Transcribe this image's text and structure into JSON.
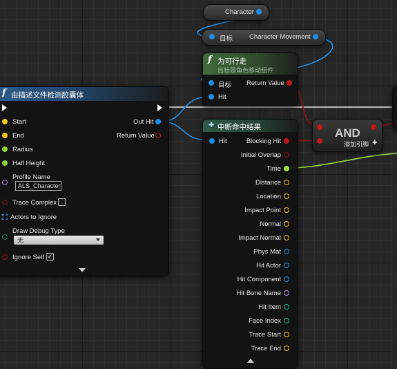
{
  "colors": {
    "exec": "#ffffff",
    "vector": "#f5c518",
    "float": "#89d33b",
    "object": "#1f8ee8",
    "bool": "#8b1414",
    "name": "#b286e8",
    "struct": "#0a6fb8",
    "lime": "#a0e040",
    "teal": "#22b8a0"
  },
  "character_node": {
    "label": "Character"
  },
  "movement_node": {
    "target_label": "目标",
    "output_label": "Character Movement"
  },
  "can_move_node": {
    "title": "为可行走",
    "subtitle": "目标是角色移动组件",
    "target_label": "目标",
    "hit_label": "Hit",
    "return_label": "Return Value"
  },
  "capsule_trace_node": {
    "title": "由描述文件检测胶囊体",
    "inputs": {
      "start": "Start",
      "end": "End",
      "radius": "Radius",
      "half_height": "Half Height",
      "profile_name": "Profile Name",
      "profile_value": "ALS_Character",
      "trace_complex": "Trace Complex",
      "actors_to_ignore": "Actors to Ignore",
      "draw_debug_type": "Draw Debug Type",
      "draw_debug_value": "无",
      "ignore_self": "Ignore Self"
    },
    "outputs": {
      "out_hit": "Out Hit",
      "return_value": "Return Value"
    },
    "trace_complex_checked": false,
    "ignore_self_checked": true
  },
  "break_hit_node": {
    "title": "中断命中结果",
    "input_label": "Hit",
    "outputs": [
      {
        "label": "Blocking Hit",
        "pin": "bool"
      },
      {
        "label": "Initial Overlap",
        "pin": "bool"
      },
      {
        "label": "Time",
        "pin": "float"
      },
      {
        "label": "Distance",
        "pin": "vector"
      },
      {
        "label": "Location",
        "pin": "vector"
      },
      {
        "label": "Impact Point",
        "pin": "vector"
      },
      {
        "label": "Normal",
        "pin": "vector"
      },
      {
        "label": "Impact Normal",
        "pin": "vector"
      },
      {
        "label": "Phys Mat",
        "pin": "object"
      },
      {
        "label": "Hit Actor",
        "pin": "object"
      },
      {
        "label": "Hit Component",
        "pin": "object"
      },
      {
        "label": "Hit Bone Name",
        "pin": "name"
      },
      {
        "label": "Hit Item",
        "pin": "teal"
      },
      {
        "label": "Face Index",
        "pin": "teal"
      },
      {
        "label": "Trace Start",
        "pin": "vector"
      },
      {
        "label": "Trace End",
        "pin": "vector"
      }
    ]
  },
  "and_node": {
    "title": "AND",
    "add_pin_label": "添加引脚",
    "add_pin_icon": "plus-icon"
  }
}
